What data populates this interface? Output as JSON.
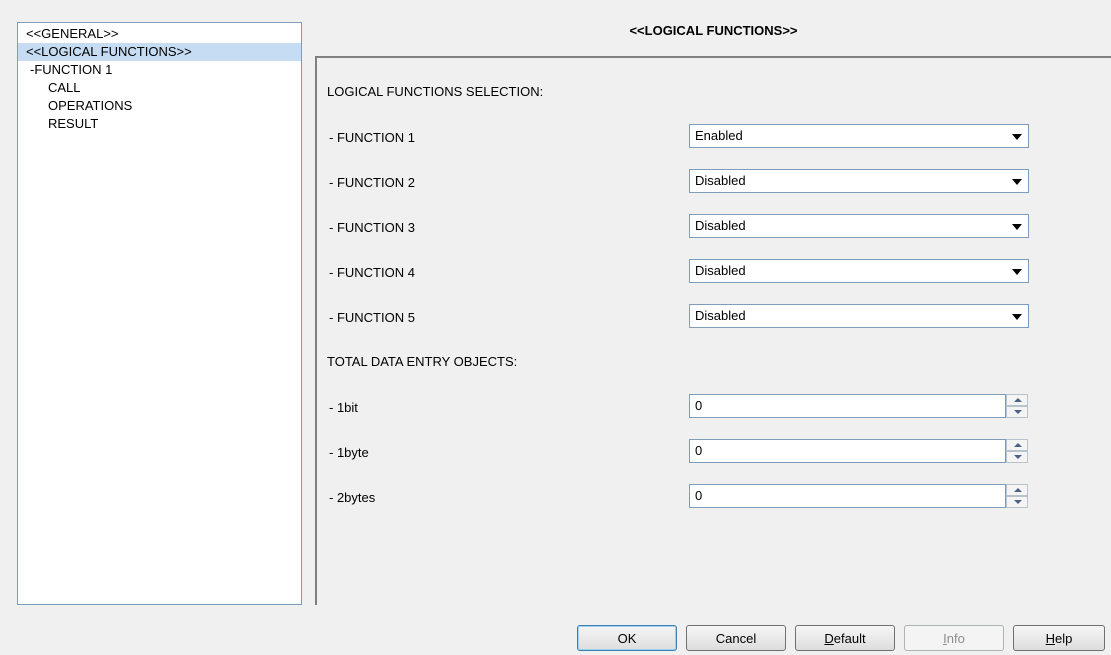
{
  "tree": {
    "items": [
      {
        "label": "<<GENERAL>>"
      },
      {
        "label": "<<LOGICAL FUNCTIONS>>"
      },
      {
        "label": "-FUNCTION 1"
      },
      {
        "label": "CALL"
      },
      {
        "label": "OPERATIONS"
      },
      {
        "label": "RESULT"
      }
    ]
  },
  "header": {
    "title": "<<LOGICAL FUNCTIONS>>"
  },
  "main": {
    "selection_heading": "LOGICAL FUNCTIONS SELECTION:",
    "functions": [
      {
        "label": "- FUNCTION 1",
        "value": "Enabled"
      },
      {
        "label": "- FUNCTION 2",
        "value": "Disabled"
      },
      {
        "label": "- FUNCTION 3",
        "value": "Disabled"
      },
      {
        "label": "- FUNCTION 4",
        "value": "Disabled"
      },
      {
        "label": "- FUNCTION 5",
        "value": "Disabled"
      }
    ],
    "entry_heading": "TOTAL DATA ENTRY OBJECTS:",
    "entries": [
      {
        "label": "- 1bit",
        "value": "0"
      },
      {
        "label": "- 1byte",
        "value": "0"
      },
      {
        "label": "- 2bytes",
        "value": "0"
      }
    ]
  },
  "buttons": {
    "ok": "OK",
    "cancel": "Cancel",
    "default_first": "D",
    "default_rest": "efault",
    "info_first": "I",
    "info_rest": "nfo",
    "help_first": "H",
    "help_rest": "elp"
  },
  "colors": {
    "selection": "#c5dcf3",
    "border": "#7f9db9",
    "background": "#f0f0f0"
  }
}
